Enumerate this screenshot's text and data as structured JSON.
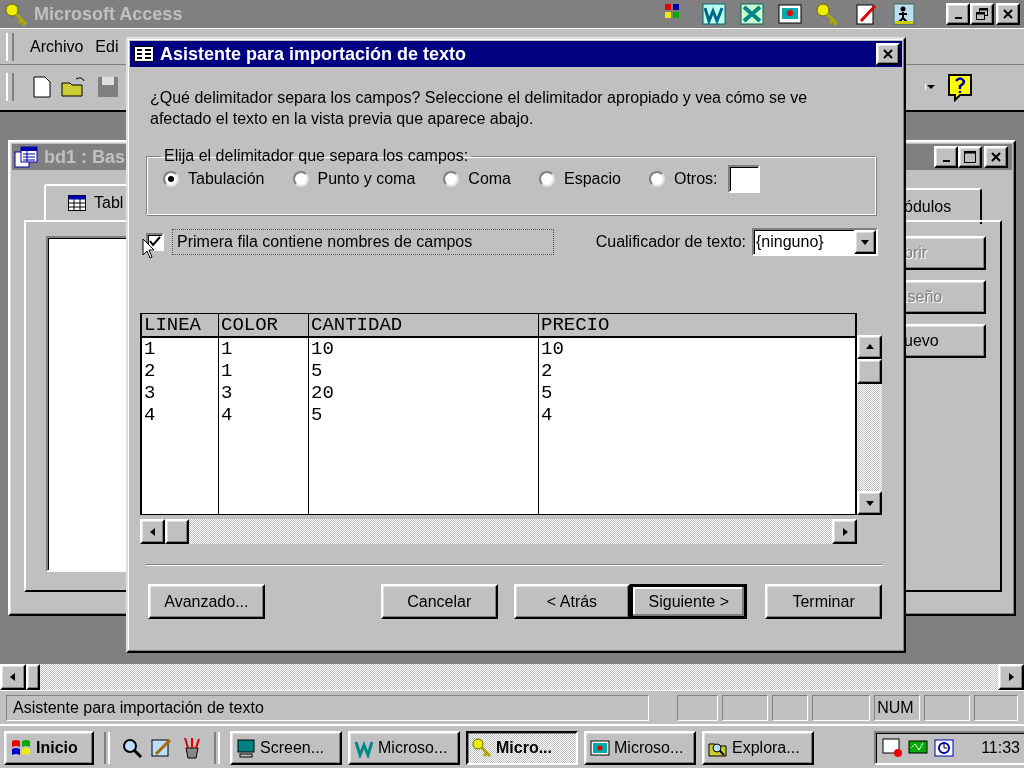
{
  "app_window": {
    "title": "Microsoft Access"
  },
  "menu_bar": [
    "Archivo",
    "Edi"
  ],
  "db_window": {
    "title": "bd1 : Bas",
    "tabs": [
      "Tabl",
      "ódulos"
    ],
    "buttons": [
      {
        "label": "brir",
        "disabled": true
      },
      {
        "label": "iseño",
        "disabled": true
      },
      {
        "label": "uevo",
        "disabled": false
      }
    ]
  },
  "dialog": {
    "title": "Asistente para importación de texto",
    "instructions": "¿Qué delimitador separa los campos? Seleccione el delimitador apropiado y vea cómo se ve afectado el texto en la vista previa que aparece abajo.",
    "delimiter_group": {
      "label": "Elija el delimitador que separa los campos:",
      "options": [
        {
          "label": "Tabulación",
          "selected": true
        },
        {
          "label": "Punto y coma",
          "selected": false
        },
        {
          "label": "Coma",
          "selected": false
        },
        {
          "label": "Espacio",
          "selected": false
        },
        {
          "label": "Otros:",
          "selected": false
        }
      ]
    },
    "first_row_checkbox": {
      "label": "Primera fila contiene nombres de campos",
      "checked": true
    },
    "qualifier": {
      "label": "Cualificador de texto:",
      "value": "{ninguno}"
    },
    "preview": {
      "columns": [
        "LINEA",
        "COLOR",
        "CANTIDAD",
        "PRECIO"
      ],
      "rows": [
        [
          "1",
          "1",
          "10",
          "10"
        ],
        [
          "2",
          "1",
          "5",
          "2"
        ],
        [
          "3",
          "3",
          "20",
          "5"
        ],
        [
          "4",
          "4",
          "5",
          "4"
        ]
      ]
    },
    "buttons": [
      {
        "label": "Avanzado...",
        "default": false
      },
      {
        "label": "Cancelar",
        "default": false
      },
      {
        "label": "< Atrás",
        "default": false
      },
      {
        "label": "Siguiente >",
        "default": true
      },
      {
        "label": "Terminar",
        "default": false
      }
    ]
  },
  "status_bar": {
    "text": "Asistente para importación de texto",
    "indicators": [
      "NUM"
    ]
  },
  "taskbar": {
    "start": "Inicio",
    "tasks": [
      {
        "label": "Screen...",
        "selected": false
      },
      {
        "label": "Microso...",
        "selected": false
      },
      {
        "label": "Micro...",
        "selected": true
      },
      {
        "label": "Microso...",
        "selected": false
      },
      {
        "label": "Explora...",
        "selected": false
      }
    ],
    "clock": "11:33"
  }
}
